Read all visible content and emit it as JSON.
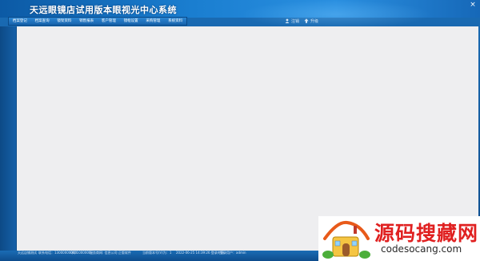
{
  "window": {
    "title": "天远眼镜店试用版本眼视光中心系统",
    "close_label": "×"
  },
  "header": {
    "actions": [
      {
        "label": "注销",
        "icon": "logout-icon"
      },
      {
        "label": "升级",
        "icon": "upgrade-icon"
      }
    ]
  },
  "menu": {
    "items": [
      {
        "label": "档案登记"
      },
      {
        "label": "档案查询"
      },
      {
        "label": "镜架资料"
      },
      {
        "label": "销售报表"
      },
      {
        "label": "客户管理"
      },
      {
        "label": "镜框设置"
      },
      {
        "label": "采购管理"
      },
      {
        "label": "系统资料"
      }
    ]
  },
  "status": {
    "shop": "天远店铺测试",
    "contact": "联系电话：13000000000",
    "qq": "QQ:1000000",
    "service": "服务商网: 信息公司 正版软件",
    "version": "当前版本号(V)为：1",
    "login_time": "2022-06-25 14:39:26 登录时间",
    "user": "登录用户：admin"
  },
  "watermark": {
    "text": "源码搜藏网",
    "url": "codesocang.com"
  },
  "colors": {
    "accent": "#1a6cb5",
    "content_bg": "#eeeef0",
    "watermark_red": "#e02020"
  }
}
